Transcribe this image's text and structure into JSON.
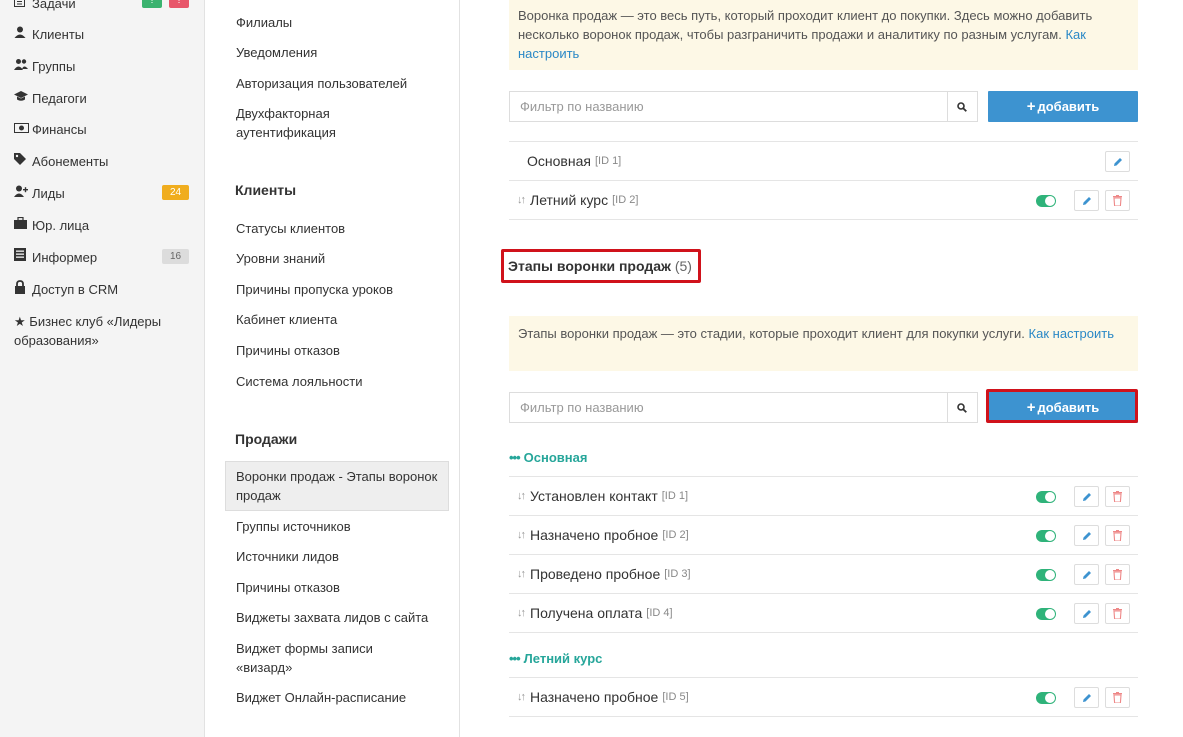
{
  "sidebar": {
    "items": [
      {
        "label": "Задачи",
        "icon": "tasks-icon"
      },
      {
        "label": "Клиенты",
        "icon": "user-icon"
      },
      {
        "label": "Группы",
        "icon": "users-icon"
      },
      {
        "label": "Педагоги",
        "icon": "graduation-cap-icon"
      },
      {
        "label": "Финансы",
        "icon": "money-icon"
      },
      {
        "label": "Абонементы",
        "icon": "tag-icon"
      },
      {
        "label": "Лиды",
        "icon": "user-plus-icon",
        "badge": "24"
      },
      {
        "label": "Юр. лица",
        "icon": "briefcase-icon"
      },
      {
        "label": "Информер",
        "icon": "newspaper-icon",
        "badge": "16"
      },
      {
        "label": "Доступ в CRM",
        "icon": "lock-icon"
      },
      {
        "label": "Бизнес клуб «Лидеры образования»",
        "icon": "star-icon"
      }
    ],
    "task_badges": [
      "!",
      "!"
    ]
  },
  "subnav": {
    "top_links": [
      "Филиалы",
      "Уведомления",
      "Авторизация пользователей",
      "Двухфакторная аутентификация"
    ],
    "clients_heading": "Клиенты",
    "clients_links": [
      "Статусы клиентов",
      "Уровни знаний",
      "Причины пропуска уроков",
      "Кабинет клиента",
      "Причины отказов",
      "Система лояльности"
    ],
    "sales_heading": "Продажи",
    "sales_active": "Воронки продаж - Этапы воронок продаж",
    "sales_links": [
      "Группы источников",
      "Источники лидов",
      "Причины отказов",
      "Виджеты захвата лидов с сайта",
      "Виджет формы записи «визард»",
      "Виджет Онлайн-расписание"
    ]
  },
  "funnels": {
    "info_text": "Воронка продаж — это весь путь, который проходит клиент до покупки. Здесь можно добавить несколько воронок продаж, чтобы разграничить продажи и аналитику по разным услугам.",
    "info_link": "Как настроить",
    "filter_placeholder": "Фильтр по названию",
    "add_label": "добавить",
    "rows": [
      {
        "name": "Основная",
        "id": "[ID 1]"
      },
      {
        "name": "Летний курс",
        "id": "[ID 2]"
      }
    ]
  },
  "stages": {
    "title": "Этапы воронки продаж",
    "count": "(5)",
    "info_text": "Этапы воронки продаж — это стадии, которые проходит клиент для покупки услуги.",
    "info_link": "Как настроить",
    "filter_placeholder": "Фильтр по названию",
    "add_label": "добавить",
    "groups": [
      {
        "title": "Основная",
        "rows": [
          {
            "name": "Установлен контакт",
            "id": "[ID 1]"
          },
          {
            "name": "Назначено пробное",
            "id": "[ID 2]"
          },
          {
            "name": "Проведено пробное",
            "id": "[ID 3]"
          },
          {
            "name": "Получена оплата",
            "id": "[ID 4]"
          }
        ]
      },
      {
        "title": "Летний курс",
        "rows": [
          {
            "name": "Назначено пробное",
            "id": "[ID 5]"
          }
        ]
      }
    ]
  },
  "colors": {
    "accent": "#3d93d0",
    "highlight": "#d0121b",
    "group": "#26a69a",
    "toggle": "#2fb37a"
  }
}
